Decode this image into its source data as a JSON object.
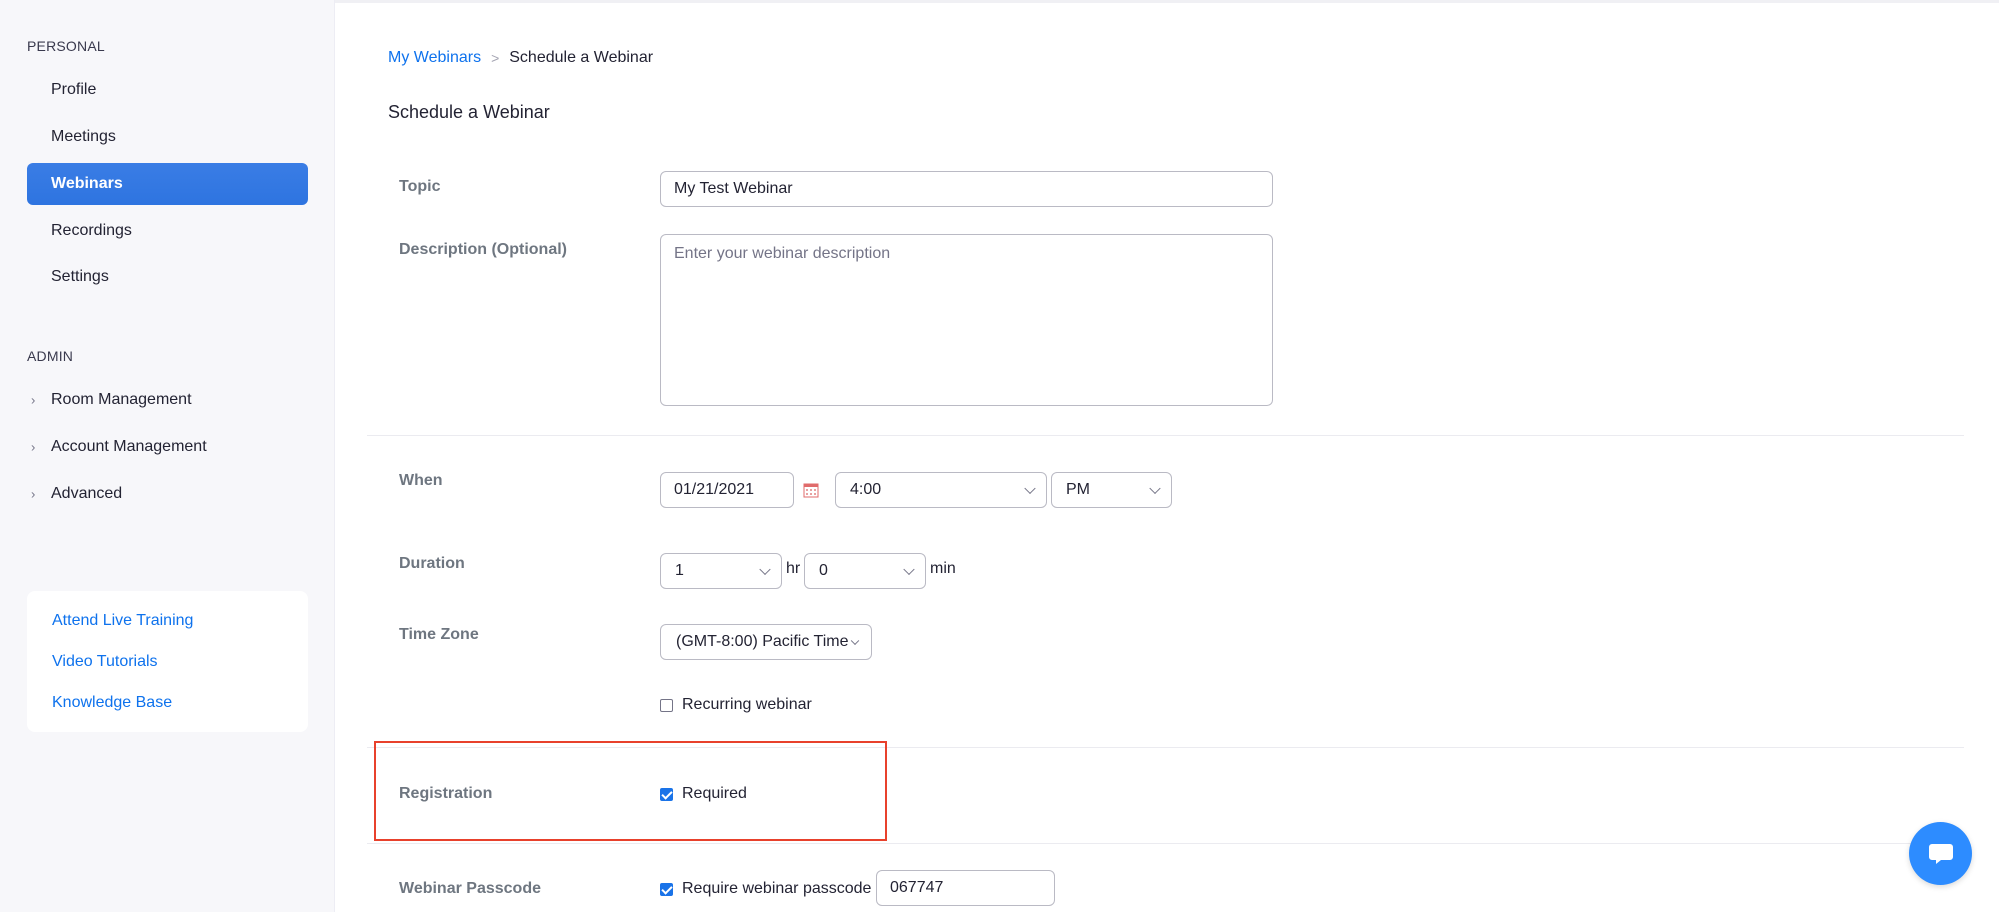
{
  "sidebar": {
    "personal_heading": "PERSONAL",
    "personal_items": [
      {
        "label": "Profile"
      },
      {
        "label": "Meetings"
      },
      {
        "label": "Webinars"
      },
      {
        "label": "Recordings"
      },
      {
        "label": "Settings"
      }
    ],
    "admin_heading": "ADMIN",
    "admin_items": [
      {
        "label": "Room Management"
      },
      {
        "label": "Account Management"
      },
      {
        "label": "Advanced"
      }
    ],
    "help_links": [
      {
        "label": "Attend Live Training"
      },
      {
        "label": "Video Tutorials"
      },
      {
        "label": "Knowledge Base"
      }
    ]
  },
  "breadcrumb": {
    "parent": "My Webinars",
    "separator": ">",
    "current": "Schedule a Webinar"
  },
  "page_title": "Schedule a Webinar",
  "form": {
    "topic": {
      "label": "Topic",
      "value": "My Test Webinar"
    },
    "description": {
      "label": "Description (Optional)",
      "placeholder": "Enter your webinar description"
    },
    "when": {
      "label": "When",
      "date": "01/21/2021",
      "time": "4:00",
      "ampm": "PM"
    },
    "duration": {
      "label": "Duration",
      "hours": "1",
      "hours_unit": "hr",
      "minutes": "0",
      "minutes_unit": "min"
    },
    "time_zone": {
      "label": "Time Zone",
      "value": "(GMT-8:00) Pacific Time"
    },
    "recurring": {
      "label": "Recurring webinar",
      "checked": false
    },
    "registration": {
      "label": "Registration",
      "option_label": "Required",
      "checked": true
    },
    "passcode": {
      "label": "Webinar Passcode",
      "option_label": "Require webinar passcode",
      "checked": true,
      "value": "067747"
    }
  },
  "colors": {
    "accent": "#2d8cff",
    "link": "#0e72ed",
    "highlight": "#e8412c"
  }
}
